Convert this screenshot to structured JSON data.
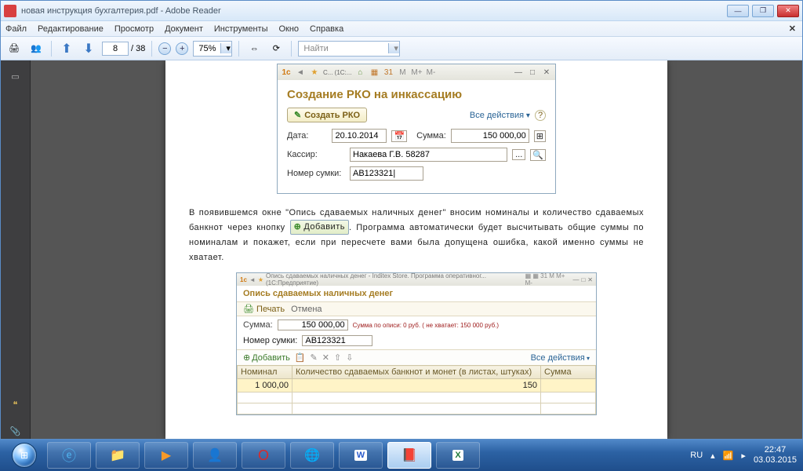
{
  "window": {
    "title": "новая инструкция бухгалтерия.pdf - Adobe Reader"
  },
  "menubar": [
    "Файл",
    "Редактирование",
    "Просмотр",
    "Документ",
    "Инструменты",
    "Окно",
    "Справка"
  ],
  "toolbar": {
    "page_current": "8",
    "page_total": "/ 38",
    "zoom": "75%",
    "find_placeholder": "Найти"
  },
  "doc": {
    "dlg1": {
      "tb_text": "С...  (1С:...",
      "title": "Создание РКО на инкассацию",
      "create_btn": "Создать РКО",
      "all_actions": "Все действия",
      "date_label": "Дата:",
      "date_value": "20.10.2014",
      "sum_label": "Сумма:",
      "sum_value": "150 000,00",
      "cashier_label": "Кассир:",
      "cashier_value": "Накаева Г.В. 58287",
      "bag_label": "Номер сумки:",
      "bag_value": "АВ123321|"
    },
    "para1a": "В появившемся окне \"Опись сдаваемых наличных денег\" вносим номиналы и количество сдаваемых банкнот через кнопку",
    "add_btn": "Добавить",
    "para1b": ".  Программа автоматически будет высчитывать общие суммы по номиналам и покажет, если при пересчете вами была допущена ошибка, какой именно суммы не хватает.",
    "dlg2": {
      "tb_text": "Опись сдаваемых наличных денег - Inditex Store.  Программа оперативног...   (1С:Предприятие)",
      "title": "Опись сдаваемых наличных денег",
      "print": "Печать",
      "cancel": "Отмена",
      "sum_label": "Сумма:",
      "sum_value": "150 000,00",
      "warn": "Сумма по описи: 0 руб. ( не хватает:  150 000 руб.)",
      "bag_label": "Номер сумки:",
      "bag_value": "АВ123321",
      "add": "Добавить",
      "all_actions": "Все действия",
      "col1": "Номинал",
      "col2": "Количество сдаваемых банкнот и монет (в листах, штуках)",
      "col3": "Сумма",
      "row_nominal": "1 000,00",
      "row_qty": "150"
    }
  },
  "taskbar": {
    "lang": "RU",
    "time": "22:47",
    "date": "03.03.2015"
  }
}
